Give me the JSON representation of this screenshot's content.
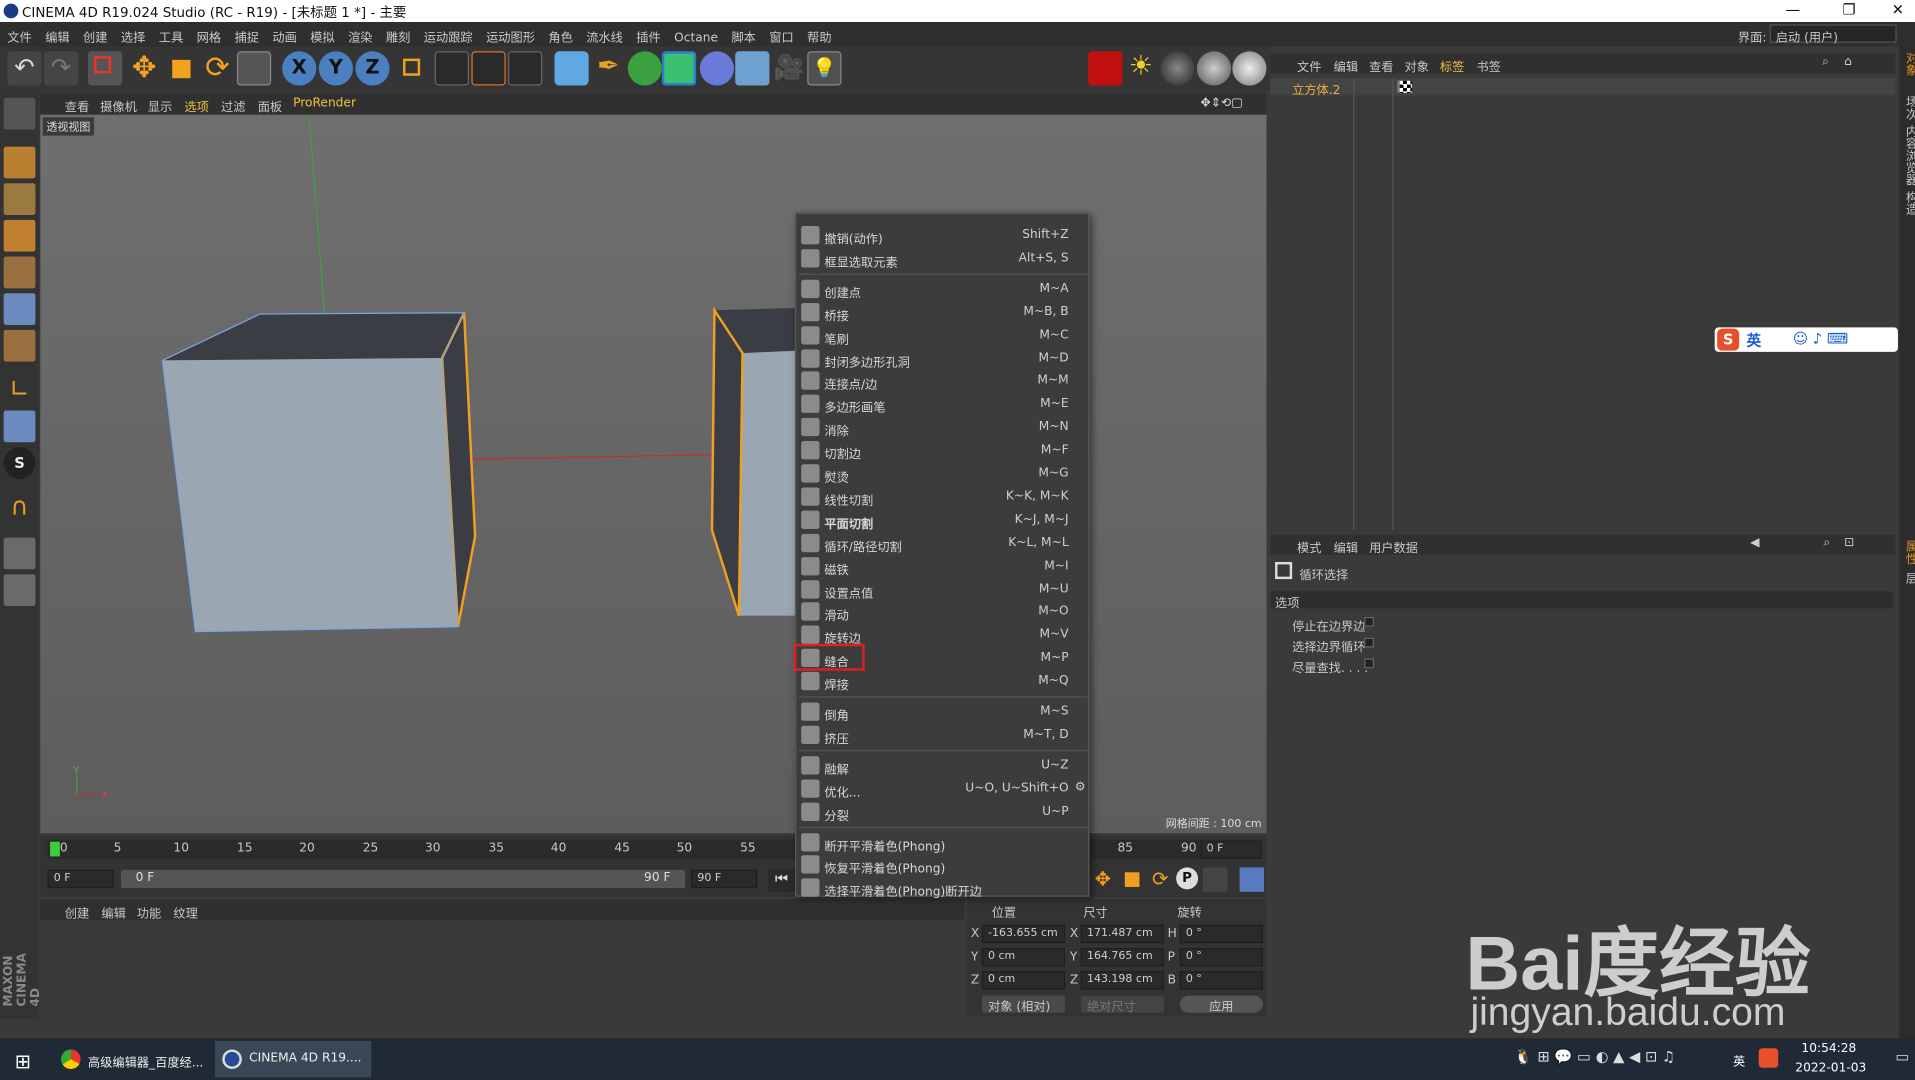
{
  "window": {
    "title": "CINEMA 4D R19.024 Studio (RC - R19) - [未标题 1 *] - 主要",
    "min": "—",
    "restore": "❐",
    "close": "✕"
  },
  "menubar": {
    "items": [
      "文件",
      "编辑",
      "创建",
      "选择",
      "工具",
      "网格",
      "捕捉",
      "动画",
      "模拟",
      "渲染",
      "雕刻",
      "运动跟踪",
      "运动图形",
      "角色",
      "流水线",
      "插件",
      "Octane",
      "脚本",
      "窗口",
      "帮助"
    ],
    "layout_label": "界面:",
    "layout_value": "启动 (用户)"
  },
  "toolbar": {
    "xyz": [
      "X",
      "Y",
      "Z"
    ]
  },
  "viewport": {
    "menu": [
      "查看",
      "摄像机",
      "显示",
      "选项",
      "过滤",
      "面板",
      "ProRender"
    ],
    "name": "透视视图",
    "grid_info": "网格间距 : 100 cm",
    "axis_y": "Y",
    "axis_x": "X"
  },
  "context_menu": {
    "groups": [
      [
        {
          "label": "撤销(动作)",
          "shortcut": "Shift+Z",
          "icon": "undo-icon"
        },
        {
          "label": "框显选取元素",
          "shortcut": "Alt+S, S",
          "icon": "frame-selection-icon"
        }
      ],
      [
        {
          "label": "创建点",
          "shortcut": "M~A",
          "icon": "create-point-icon"
        },
        {
          "label": "桥接",
          "shortcut": "M~B, B",
          "icon": "bridge-icon"
        },
        {
          "label": "笔刷",
          "shortcut": "M~C",
          "icon": "brush-icon"
        },
        {
          "label": "封闭多边形孔洞",
          "shortcut": "M~D",
          "icon": "close-hole-icon"
        },
        {
          "label": "连接点/边",
          "shortcut": "M~M",
          "icon": "connect-icon"
        },
        {
          "label": "多边形画笔",
          "shortcut": "M~E",
          "icon": "polygon-pen-icon"
        },
        {
          "label": "消除",
          "shortcut": "M~N",
          "icon": "dissolve-icon"
        },
        {
          "label": "切割边",
          "shortcut": "M~F",
          "icon": "edge-cut-icon"
        },
        {
          "label": "熨烫",
          "shortcut": "M~G",
          "icon": "iron-icon"
        },
        {
          "label": "线性切割",
          "shortcut": "K~K, M~K",
          "icon": "knife-icon"
        },
        {
          "label": "平面切割",
          "shortcut": "K~J, M~J",
          "icon": "plane-cut-icon",
          "bold": true
        },
        {
          "label": "循环/路径切割",
          "shortcut": "K~L, M~L",
          "icon": "loop-cut-icon"
        },
        {
          "label": "磁铁",
          "shortcut": "M~I",
          "icon": "magnet-icon"
        },
        {
          "label": "设置点值",
          "shortcut": "M~U",
          "icon": "set-point-icon"
        },
        {
          "label": "滑动",
          "shortcut": "M~O",
          "icon": "slide-icon"
        },
        {
          "label": "旋转边",
          "shortcut": "M~V",
          "icon": "spin-edge-icon"
        },
        {
          "label": "缝合",
          "shortcut": "M~P",
          "icon": "stitch-icon",
          "highlight": true
        },
        {
          "label": "焊接",
          "shortcut": "M~Q",
          "icon": "weld-icon"
        }
      ],
      [
        {
          "label": "倒角",
          "shortcut": "M~S",
          "icon": "bevel-icon"
        },
        {
          "label": "挤压",
          "shortcut": "M~T, D",
          "icon": "extrude-icon"
        }
      ],
      [
        {
          "label": "融解",
          "shortcut": "U~Z",
          "icon": "melt-icon"
        },
        {
          "label": "优化...",
          "shortcut": "U~O, U~Shift+O",
          "icon": "optimize-icon",
          "gear": true
        },
        {
          "label": "分裂",
          "shortcut": "U~P",
          "icon": "split-icon"
        }
      ],
      [
        {
          "label": "断开平滑着色(Phong)",
          "shortcut": "",
          "icon": "break-phong-icon"
        },
        {
          "label": "恢复平滑着色(Phong)",
          "shortcut": "",
          "icon": "unbreak-phong-icon"
        },
        {
          "label": "选择平滑着色(Phong)断开边",
          "shortcut": "",
          "icon": "select-phong-icon"
        }
      ]
    ]
  },
  "timeline": {
    "ticks": [
      "0",
      "5",
      "10",
      "15",
      "20",
      "25",
      "30",
      "35",
      "40",
      "45",
      "50",
      "55",
      "85",
      "90"
    ],
    "frame_end_box": "0 F",
    "start": "0 F",
    "range_start": "0 F",
    "range_end": "90 F",
    "end": "90 F"
  },
  "materials": {
    "menu": [
      "创建",
      "编辑",
      "功能",
      "纹理"
    ]
  },
  "coords": {
    "headers": [
      "位置",
      "尺寸",
      "旋转"
    ],
    "rows": [
      [
        "X",
        "-163.655 cm",
        "X",
        "171.487 cm",
        "H",
        "0 °"
      ],
      [
        "Y",
        "0 cm",
        "Y",
        "164.765 cm",
        "P",
        "0 °"
      ],
      [
        "Z",
        "0 cm",
        "Z",
        "143.198 cm",
        "B",
        "0 °"
      ]
    ],
    "mode": "对象 (相对)",
    "size_mode": "绝对尺寸",
    "apply": "应用"
  },
  "objects": {
    "menu": [
      "文件",
      "编辑",
      "查看",
      "对象",
      "标签",
      "书签"
    ],
    "item": "立方体.2"
  },
  "attributes": {
    "menu": [
      "模式",
      "编辑",
      "用户数据"
    ],
    "tool": "循环选择",
    "section": "选项",
    "options": [
      "停止在边界边",
      "选择边界循环",
      "尽量查找. . . ."
    ]
  },
  "sidetabs": [
    "对象",
    "场次",
    "内容浏览器",
    "构造",
    "属性",
    "层"
  ],
  "ime": {
    "label": "英"
  },
  "taskbar": {
    "apps": [
      "高级编辑器_百度经...",
      "CINEMA 4D R19...."
    ],
    "time": "10:54:28",
    "date": "2022-01-03",
    "lang": "英"
  },
  "watermark": {
    "brand": "Bai度经验",
    "url": "jingyan.baidu.com"
  },
  "maxon": {
    "line1": "MAXON",
    "line2": "CINEMA 4D"
  },
  "colors": {
    "accent_orange": "#f0a020",
    "highlight_red": "#e02020"
  }
}
